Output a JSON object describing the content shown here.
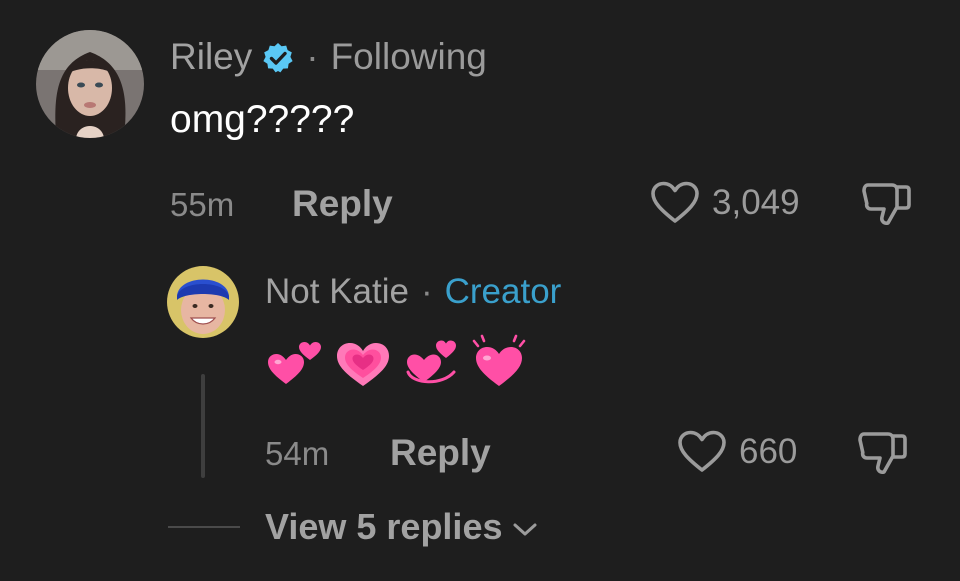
{
  "comment": {
    "author": "Riley",
    "separator": "·",
    "relation": "Following",
    "text": "omg?????",
    "time": "55m",
    "reply_label": "Reply",
    "like_count": "3,049"
  },
  "reply": {
    "author": "Not Katie",
    "separator": "·",
    "tag": "Creator",
    "emojis": [
      "two-hearts",
      "growing-heart",
      "revolving-hearts",
      "beating-heart"
    ],
    "time": "54m",
    "reply_label": "Reply",
    "like_count": "660"
  },
  "view_replies_label": "View 5 replies",
  "colors": {
    "background": "#1e1e1e",
    "verified": "#5ac8f5",
    "creator_tag": "#3aa0cc",
    "emoji_pink": "#ff4fa6"
  }
}
